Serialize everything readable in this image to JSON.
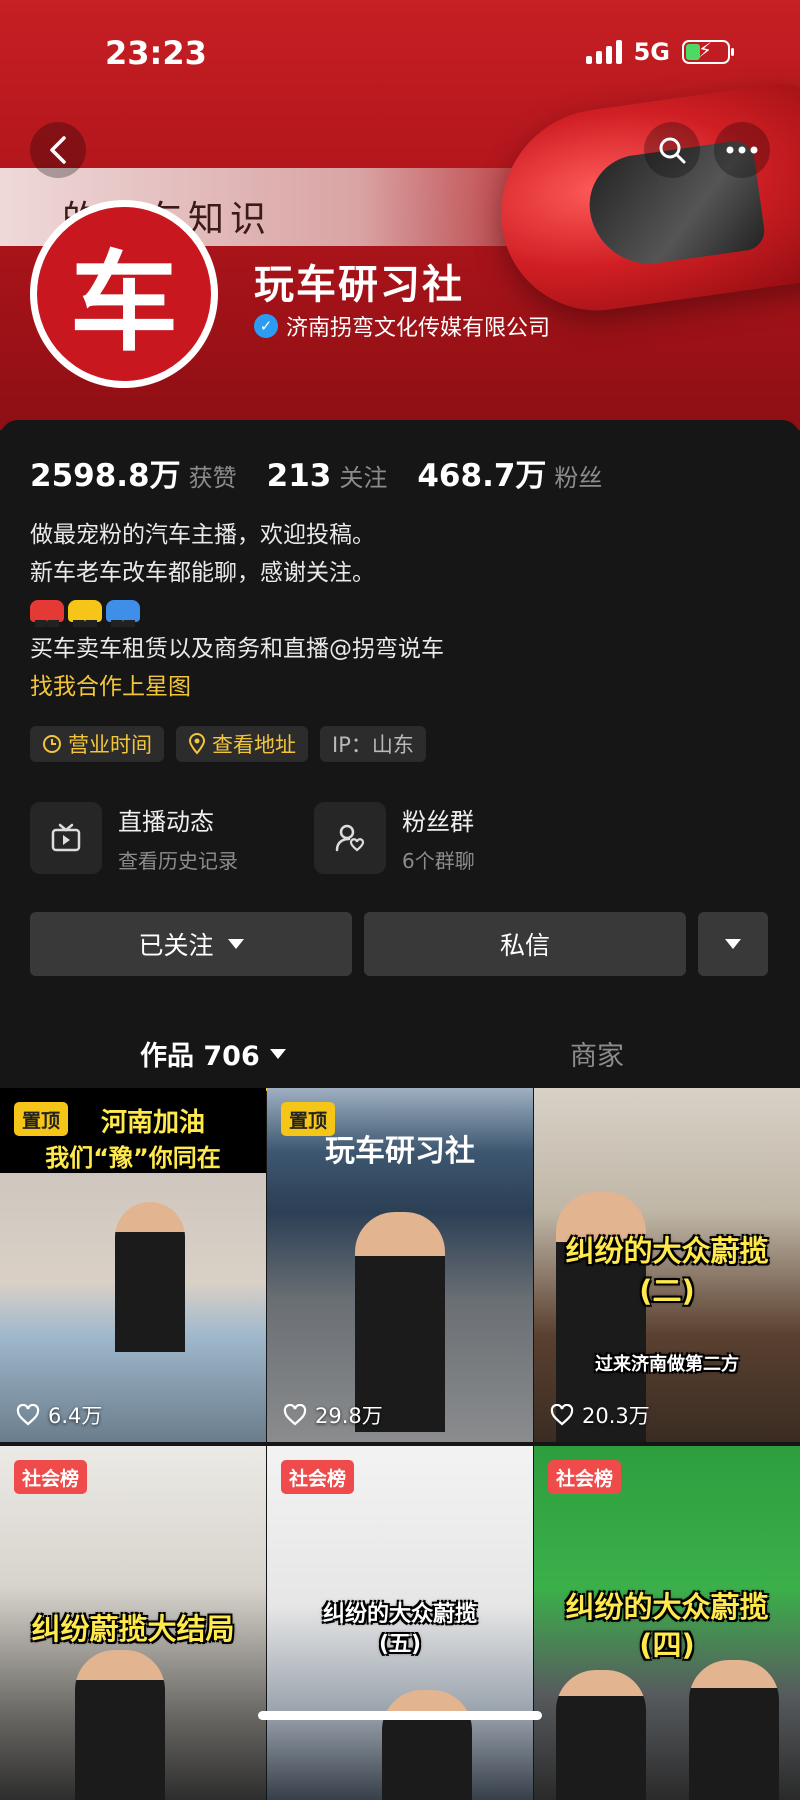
{
  "status_bar": {
    "time": "23:23",
    "network": "5G"
  },
  "banner": {
    "slogan": "的汽车知识"
  },
  "profile": {
    "avatar_char": "车",
    "name": "玩车研习社",
    "verification": "济南拐弯文化传媒有限公司"
  },
  "stats": [
    {
      "value": "2598.8万",
      "label": "获赞"
    },
    {
      "value": "213",
      "label": "关注"
    },
    {
      "value": "468.7万",
      "label": "粉丝"
    }
  ],
  "bio": {
    "line1": "做最宠粉的汽车主播，欢迎投稿。",
    "line2": "新车老车改车都能聊，感谢关注。",
    "line4": "买车卖车租赁以及商务和直播@拐弯说车",
    "link": "找我合作上星图"
  },
  "tags": {
    "hours": "营业时间",
    "address": "查看地址",
    "ip": "IP：山东"
  },
  "features": {
    "live": {
      "title": "直播动态",
      "sub": "查看历史记录"
    },
    "fans": {
      "title": "粉丝群",
      "sub": "6个群聊"
    }
  },
  "buttons": {
    "follow": "已关注",
    "message": "私信"
  },
  "tabs": {
    "works": "作品 706",
    "shop": "商家"
  },
  "colors": {
    "accent": "#f3c53b",
    "banner": "#c61f24",
    "verify": "#2b9cf2",
    "social_badge": "#ef4b4b"
  },
  "videos": [
    {
      "badge": "置顶",
      "title_line1": "河南加油",
      "title_line2": "我们“豫”你同在",
      "likes": "6.4万"
    },
    {
      "badge": "置顶",
      "title_line1": "玩车研习社",
      "likes": "29.8万"
    },
    {
      "title_line1": "纠纷的大众蔚揽",
      "title_line2": "(二)",
      "caption": "过来济南做第二方",
      "likes": "20.3万"
    },
    {
      "badge": "社会榜",
      "title_line1": "纠纷蔚揽大结局"
    },
    {
      "badge": "社会榜",
      "title_line1": "纠纷的大众蔚揽",
      "title_line2": "(五)"
    },
    {
      "badge": "社会榜",
      "title_line1": "纠纷的大众蔚揽",
      "title_line2": "(四)"
    }
  ]
}
